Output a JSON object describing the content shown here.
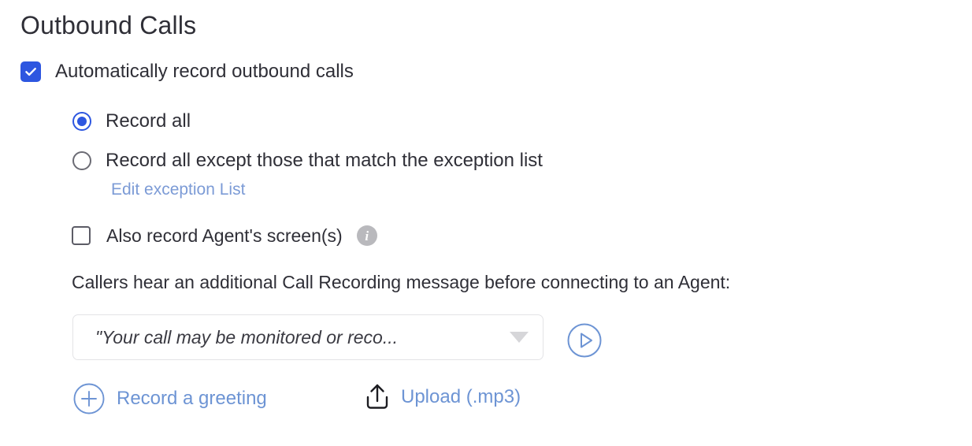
{
  "page": {
    "title": "Outbound Calls"
  },
  "auto_record": {
    "label": "Automatically record outbound calls",
    "checked": true
  },
  "record_options": [
    {
      "label": "Record all",
      "selected": true
    },
    {
      "label": "Record all except those that match the exception list",
      "selected": false
    }
  ],
  "exception_link": {
    "label": "Edit exception List"
  },
  "screen_record": {
    "label": "Also record Agent's screen(s)",
    "checked": false,
    "info_glyph": "i"
  },
  "greeting": {
    "description": "Callers hear an additional Call Recording message before connecting to an Agent:",
    "dropdown_value": "\"Your call may be monitored or reco...",
    "play_title": "Play"
  },
  "actions": {
    "record_greeting": "Record a greeting",
    "upload": "Upload (.mp3)"
  },
  "colors": {
    "accent_blue": "#2d56e0",
    "link_blue": "#7c9bd6",
    "action_blue": "#6d94d4",
    "info_grey": "#b9b9bd",
    "text": "#2f2f37",
    "border_grey": "#e3e3e6"
  }
}
